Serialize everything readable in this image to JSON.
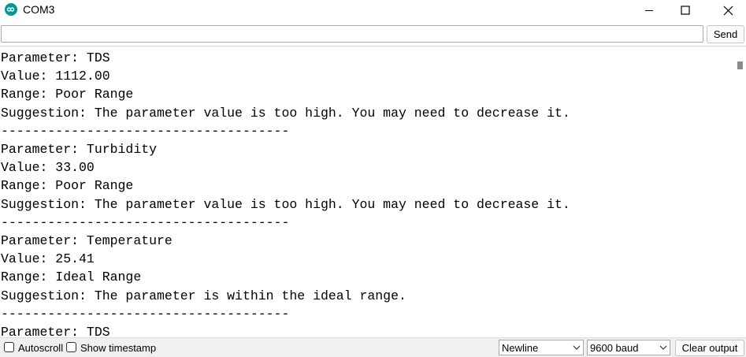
{
  "window": {
    "title": "COM3",
    "accent_color": "#00979c",
    "icons": {
      "app": "arduino-infinity-icon",
      "minimize": "minimize-icon",
      "maximize": "maximize-icon",
      "close": "close-icon"
    }
  },
  "input": {
    "value": "",
    "placeholder": "",
    "send_label": "Send"
  },
  "output": {
    "lines": [
      "Parameter: TDS",
      "Value: 1112.00",
      "Range: Poor Range",
      "Suggestion: The parameter value is too high. You may need to decrease it.",
      "-------------------------------------",
      "Parameter: Turbidity",
      "Value: 33.00",
      "Range: Poor Range",
      "Suggestion: The parameter value is too high. You may need to decrease it.",
      "-------------------------------------",
      "Parameter: Temperature",
      "Value: 25.41",
      "Range: Ideal Range",
      "Suggestion: The parameter is within the ideal range.",
      "-------------------------------------",
      "Parameter: TDS"
    ]
  },
  "footer": {
    "autoscroll_label": "Autoscroll",
    "autoscroll_checked": false,
    "timestamp_label": "Show timestamp",
    "timestamp_checked": false,
    "line_ending": "Newline",
    "baud_rate": "9600 baud",
    "clear_label": "Clear output"
  }
}
